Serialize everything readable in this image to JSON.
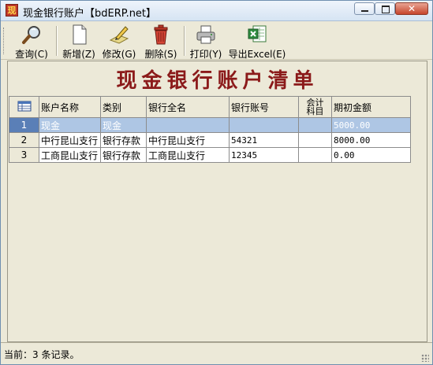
{
  "window": {
    "title": "现金银行账户【bdERP.net】",
    "app_icon_glyph": "现",
    "minimize": "minimize",
    "maximize": "maximize",
    "close_glyph": "✕"
  },
  "toolbar": {
    "items": [
      {
        "label": "查询(C)",
        "icon": "search-icon"
      },
      {
        "label": "新增(Z)",
        "icon": "new-document-icon"
      },
      {
        "label": "修改(G)",
        "icon": "edit-icon"
      },
      {
        "label": "删除(S)",
        "icon": "delete-icon"
      },
      {
        "label": "打印(Y)",
        "icon": "printer-icon"
      },
      {
        "label": "导出Excel(E)",
        "icon": "excel-icon"
      }
    ]
  },
  "heading": "现金银行账户清单",
  "table": {
    "columns": [
      "账户名称",
      "类别",
      "银行全名",
      "银行账号",
      "会计科目",
      "期初金额"
    ],
    "subject_col_line1": "会计",
    "subject_col_line2": "科目",
    "rows": [
      {
        "index": "1",
        "name": "现金",
        "type": "现金",
        "bank": "",
        "account": "",
        "subject": "",
        "opening": "5000.00",
        "selected": true
      },
      {
        "index": "2",
        "name": "中行昆山支行",
        "type": "银行存款",
        "bank": "中行昆山支行",
        "account": "54321",
        "subject": "",
        "opening": "8000.00",
        "selected": false
      },
      {
        "index": "3",
        "name": "工商昆山支行",
        "type": "银行存款",
        "bank": "工商昆山支行",
        "account": "12345",
        "subject": "",
        "opening": "0.00",
        "selected": false
      }
    ]
  },
  "status": {
    "text": "当前：3 条记录。"
  },
  "colors": {
    "accent": "#8b1a1a",
    "selection": "#aec6e4",
    "selection_index": "#5a7fb7"
  }
}
